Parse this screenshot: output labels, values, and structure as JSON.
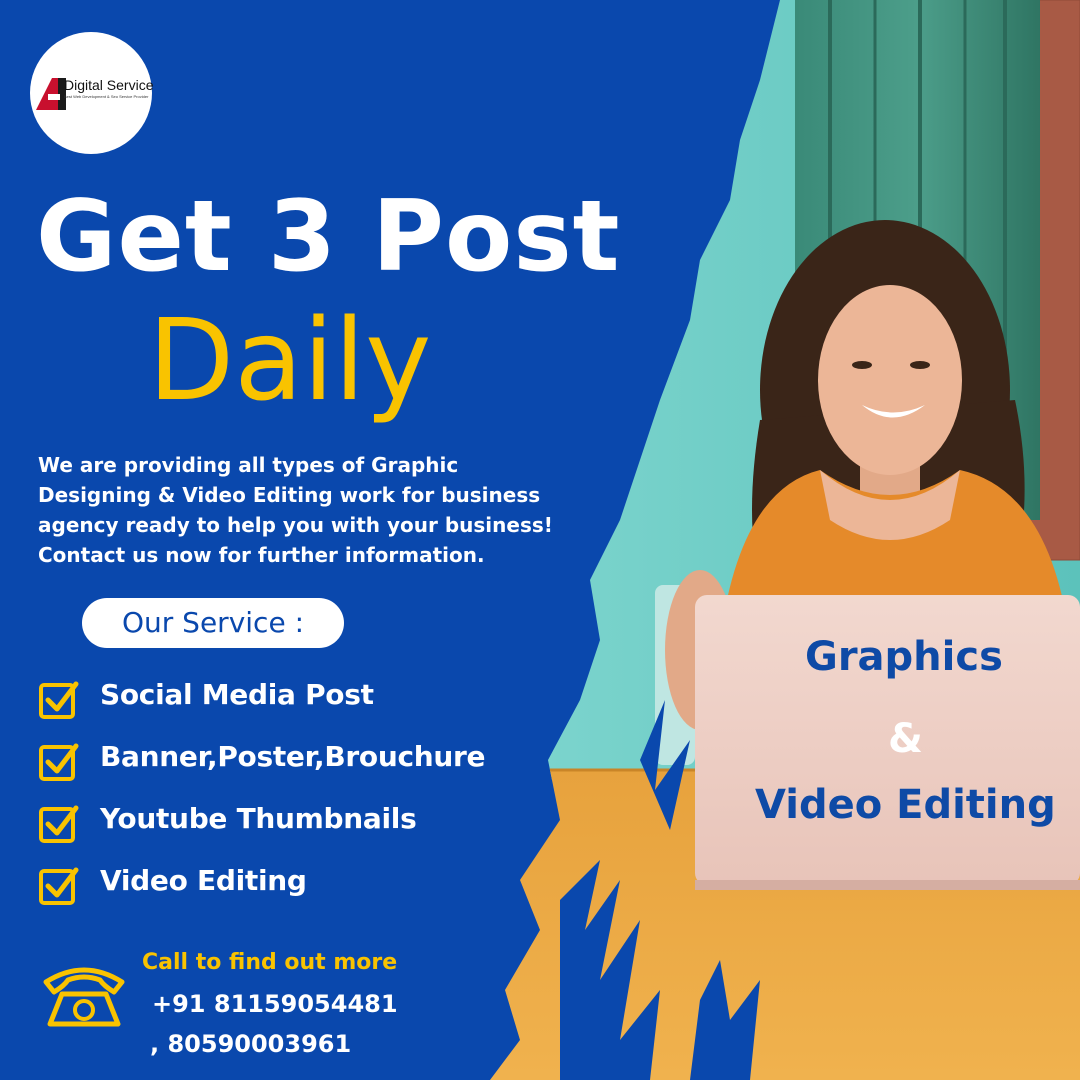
{
  "brand": {
    "name": "Digital Service",
    "tagline": "Best Web Development & Seo Service Provider"
  },
  "headline": {
    "line1": "Get 3 Post",
    "line2": "Daily"
  },
  "description": "We are providing all types of Graphic Designing & Video Editing work for business agency ready to help you with your business! Contact us now for further information.",
  "services": {
    "title": "Our Service :",
    "items": [
      {
        "label": "Social Media Post",
        "icon": "checkbox-icon"
      },
      {
        "label": "Banner,Poster,Brouchure",
        "icon": "checkbox-icon"
      },
      {
        "label": "Youtube Thumbnails",
        "icon": "checkbox-icon"
      },
      {
        "label": "Video Editing",
        "icon": "checkbox-icon"
      }
    ]
  },
  "laptop_text": {
    "line1": "Graphics",
    "line2": "&",
    "line3": "Video Editing"
  },
  "contact": {
    "title": "Call to find out more",
    "phone_line1": "+91 81159054481",
    "phone_line2": ", 80590003961",
    "icon": "phone-icon"
  },
  "colors": {
    "primary_blue": "#0a48ad",
    "accent_yellow": "#f9c300",
    "white": "#ffffff"
  }
}
